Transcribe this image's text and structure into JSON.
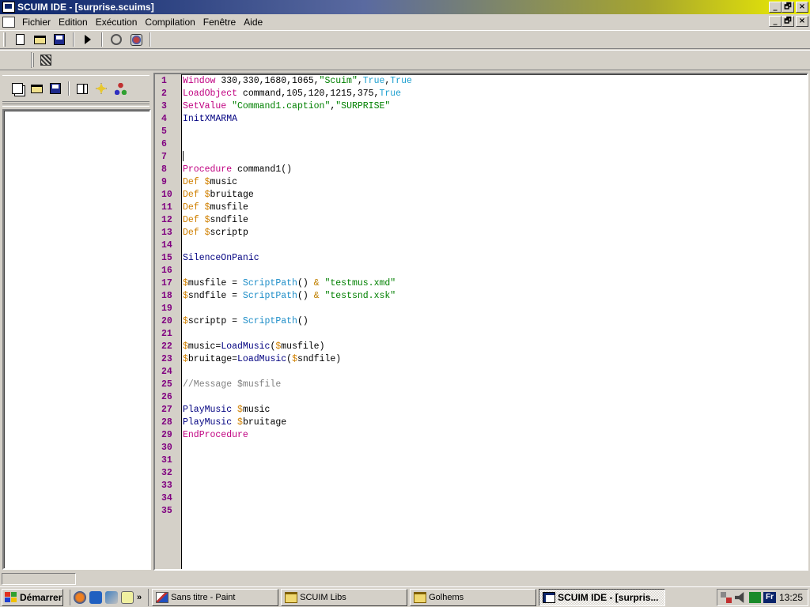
{
  "window": {
    "title": "SCUIM IDE - [surprise.scuims]",
    "controls": {
      "minimize": "_",
      "maximize": "🗗",
      "close": "×"
    }
  },
  "menu": {
    "items": [
      "Fichier",
      "Edition",
      "Exécution",
      "Compilation",
      "Fenêtre",
      "Aide"
    ]
  },
  "toolbar": {
    "icons": [
      "new-file-icon",
      "open-folder-icon",
      "save-icon",
      "run-icon",
      "library-icon",
      "settings-icon"
    ]
  },
  "toolbar2": {
    "icons": [
      "books-icon"
    ]
  },
  "left_panel": {
    "icons": [
      "copy-icon",
      "open-folder-icon",
      "save-icon",
      "properties-icon",
      "move-icon",
      "tree-icon"
    ]
  },
  "editor": {
    "lines": [
      [
        {
          "t": "Window",
          "c": "kw"
        },
        {
          "t": " 330,330,1680,1065,",
          "c": ""
        },
        {
          "t": "\"Scuim\"",
          "c": "str"
        },
        {
          "t": ",",
          "c": ""
        },
        {
          "t": "True",
          "c": "bool"
        },
        {
          "t": ",",
          "c": ""
        },
        {
          "t": "True",
          "c": "bool"
        }
      ],
      [
        {
          "t": "LoadObject",
          "c": "kw"
        },
        {
          "t": " command,105,120,1215,375,",
          "c": ""
        },
        {
          "t": "True",
          "c": "bool"
        }
      ],
      [
        {
          "t": "SetValue",
          "c": "kw"
        },
        {
          "t": " ",
          "c": ""
        },
        {
          "t": "\"Command1.caption\"",
          "c": "str"
        },
        {
          "t": ",",
          "c": ""
        },
        {
          "t": "\"SURPRISE\"",
          "c": "str"
        }
      ],
      [
        {
          "t": "InitXMARMA",
          "c": "fn"
        }
      ],
      [],
      [],
      [
        {
          "t": "|",
          "c": "caret"
        }
      ],
      [
        {
          "t": "Procedure",
          "c": "kw"
        },
        {
          "t": " command1()",
          "c": ""
        }
      ],
      [
        {
          "t": "Def",
          "c": "kw2"
        },
        {
          "t": " ",
          "c": ""
        },
        {
          "t": "$",
          "c": "var"
        },
        {
          "t": "music",
          "c": ""
        }
      ],
      [
        {
          "t": "Def",
          "c": "kw2"
        },
        {
          "t": " ",
          "c": ""
        },
        {
          "t": "$",
          "c": "var"
        },
        {
          "t": "bruitage",
          "c": ""
        }
      ],
      [
        {
          "t": "Def",
          "c": "kw2"
        },
        {
          "t": " ",
          "c": ""
        },
        {
          "t": "$",
          "c": "var"
        },
        {
          "t": "musfile",
          "c": ""
        }
      ],
      [
        {
          "t": "Def",
          "c": "kw2"
        },
        {
          "t": " ",
          "c": ""
        },
        {
          "t": "$",
          "c": "var"
        },
        {
          "t": "sndfile",
          "c": ""
        }
      ],
      [
        {
          "t": "Def",
          "c": "kw2"
        },
        {
          "t": " ",
          "c": ""
        },
        {
          "t": "$",
          "c": "var"
        },
        {
          "t": "scriptp",
          "c": ""
        }
      ],
      [],
      [
        {
          "t": "SilenceOnPanic",
          "c": "fn"
        }
      ],
      [],
      [
        {
          "t": "$",
          "c": "var"
        },
        {
          "t": "musfile = ",
          "c": ""
        },
        {
          "t": "ScriptPath",
          "c": "fn2"
        },
        {
          "t": "() ",
          "c": ""
        },
        {
          "t": "&",
          "c": "op"
        },
        {
          "t": " ",
          "c": ""
        },
        {
          "t": "\"testmus.xmd\"",
          "c": "str"
        }
      ],
      [
        {
          "t": "$",
          "c": "var"
        },
        {
          "t": "sndfile = ",
          "c": ""
        },
        {
          "t": "ScriptPath",
          "c": "fn2"
        },
        {
          "t": "() ",
          "c": ""
        },
        {
          "t": "&",
          "c": "op"
        },
        {
          "t": " ",
          "c": ""
        },
        {
          "t": "\"testsnd.xsk\"",
          "c": "str"
        }
      ],
      [],
      [
        {
          "t": "$",
          "c": "var"
        },
        {
          "t": "scriptp = ",
          "c": ""
        },
        {
          "t": "ScriptPath",
          "c": "fn2"
        },
        {
          "t": "()",
          "c": ""
        }
      ],
      [],
      [
        {
          "t": "$",
          "c": "var"
        },
        {
          "t": "music=",
          "c": ""
        },
        {
          "t": "LoadMusic",
          "c": "fn"
        },
        {
          "t": "(",
          "c": ""
        },
        {
          "t": "$",
          "c": "var"
        },
        {
          "t": "musfile)",
          "c": ""
        }
      ],
      [
        {
          "t": "$",
          "c": "var"
        },
        {
          "t": "bruitage=",
          "c": ""
        },
        {
          "t": "LoadMusic",
          "c": "fn"
        },
        {
          "t": "(",
          "c": ""
        },
        {
          "t": "$",
          "c": "var"
        },
        {
          "t": "sndfile)",
          "c": ""
        }
      ],
      [],
      [
        {
          "t": "//Message $musfile",
          "c": "com"
        }
      ],
      [],
      [
        {
          "t": "PlayMusic",
          "c": "fn"
        },
        {
          "t": " ",
          "c": ""
        },
        {
          "t": "$",
          "c": "var"
        },
        {
          "t": "music",
          "c": ""
        }
      ],
      [
        {
          "t": "PlayMusic",
          "c": "fn"
        },
        {
          "t": " ",
          "c": ""
        },
        {
          "t": "$",
          "c": "var"
        },
        {
          "t": "bruitage",
          "c": ""
        }
      ],
      [
        {
          "t": "EndProcedure",
          "c": "kw"
        }
      ],
      [],
      [],
      [],
      [],
      [],
      []
    ]
  },
  "taskbar": {
    "start_label": "Démarrer",
    "more": "»",
    "tasks": [
      {
        "label": "Sans titre - Paint",
        "icon": "paint-icon",
        "active": false
      },
      {
        "label": "SCUIM Libs",
        "icon": "folder-icon",
        "active": false
      },
      {
        "label": "Golhems",
        "icon": "folder-icon",
        "active": false
      },
      {
        "label": "SCUIM IDE - [surpris...",
        "icon": "ide-icon",
        "active": true
      }
    ],
    "tray": {
      "lang": "Fr",
      "clock": "13:25"
    }
  },
  "colors": {
    "keyword": "#c00080",
    "def": "#d08000",
    "function": "#000080",
    "string": "#008000",
    "bool": "#1ea0d0",
    "comment": "#808080",
    "linenum": "#800080"
  }
}
